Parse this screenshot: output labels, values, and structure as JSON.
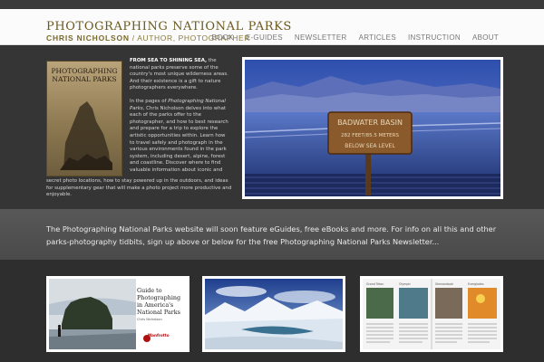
{
  "site": {
    "title": "PHOTOGRAPHING NATIONAL PARKS",
    "author_name": "CHRIS NICHOLSON",
    "author_role": "/ AUTHOR, PHOTOGRAPHER"
  },
  "nav": {
    "items": [
      {
        "label": "BOOK"
      },
      {
        "label": "E-GUIDES"
      },
      {
        "label": "NEWSLETTER"
      },
      {
        "label": "ARTICLES"
      },
      {
        "label": "INSTRUCTION"
      },
      {
        "label": "ABOUT"
      }
    ]
  },
  "book": {
    "cover_title_1": "PHOTOGRAPHING",
    "cover_title_2": "NATIONAL PARKS",
    "cover_author": "BY CHRIS NICHOLSON"
  },
  "intro": {
    "lead": "FROM SEA TO SHINING SEA,",
    "p1_rest": " the national parks preserve some of the country's most unique wilderness areas. And their existence is a gift to nature photographers everywhere.",
    "p2_a": "In the pages of ",
    "p2_em": "Photographing National Parks,",
    "p2_b": " Chris Nicholson delves into what each of the parks offer to the photographer, and how to best research and prepare for a trip to explore the artistic opportunities within. Learn how to travel safely and photograph in the various environments found in the park system, including desert, alpine, forest and coastline. Discover where to find valuable information about iconic and",
    "p2_cont": "secret photo locations, how to stay powered up in the outdoors, and ideas for supplementary gear that will make a photo project more productive and enjoyable."
  },
  "hero": {
    "sign_line1": "BADWATER BASIN",
    "sign_line2": "282 FEET/85.5 METERS",
    "sign_line3": "BELOW SEA LEVEL"
  },
  "band": {
    "text": "The Photographing National Parks website will soon feature eGuides, free eBooks and more. For info on all this and other parks-photography tidbits, sign up above or below for the free Photographing National Parks Newsletter..."
  },
  "thumbs": {
    "guide_title": "Guide to Photographing in America's National Parks",
    "guide_author": "Chris Nicholson",
    "guide_publisher": "Manfrotto",
    "spread_heads": [
      "Grand Teton",
      "Olympic",
      "Shenandoah",
      "Everglades"
    ]
  },
  "colors": {
    "title": "#6b5a1e",
    "sky": "#3a5fb8",
    "band": "#555555"
  }
}
